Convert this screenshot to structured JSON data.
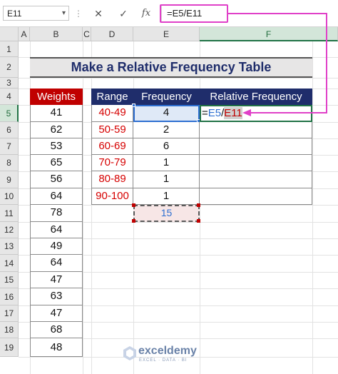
{
  "formula_bar": {
    "name_box": "E11",
    "cancel_icon": "✕",
    "enter_icon": "✓",
    "fx_label": "fx",
    "formula": "=E5/E11"
  },
  "columns": [
    "A",
    "B",
    "C",
    "D",
    "E",
    "F"
  ],
  "rows": [
    "1",
    "2",
    "3",
    "4",
    "5",
    "6",
    "7",
    "8",
    "9",
    "10",
    "11",
    "12",
    "13",
    "14",
    "15",
    "16",
    "17",
    "18",
    "19"
  ],
  "title": "Make a Relative Frequency Table",
  "weights": {
    "header": "Weights",
    "values": [
      "41",
      "62",
      "53",
      "65",
      "56",
      "64",
      "78",
      "64",
      "49",
      "64",
      "47",
      "63",
      "47",
      "68",
      "48"
    ]
  },
  "freq_table": {
    "headers": [
      "Range",
      "Frequency",
      "Relative Frequency"
    ],
    "rows": [
      {
        "range": "40-49",
        "freq": "4"
      },
      {
        "range": "50-59",
        "freq": "2"
      },
      {
        "range": "60-69",
        "freq": "6"
      },
      {
        "range": "70-79",
        "freq": "1"
      },
      {
        "range": "80-89",
        "freq": "1"
      },
      {
        "range": "90-100",
        "freq": "1"
      }
    ],
    "editing_formula": {
      "eq": "=",
      "ref1": "E5",
      "slash": "/",
      "ref2": "E11"
    },
    "total": "15"
  },
  "watermark": {
    "name": "exceldemy",
    "tagline": "EXCEL · DATA · BI"
  },
  "colors": {
    "title_text": "#1f2d6b",
    "weights_header": "#c00000",
    "table_header": "#1f2d6b",
    "range_text": "#d60000",
    "highlight": "#e040c8"
  }
}
